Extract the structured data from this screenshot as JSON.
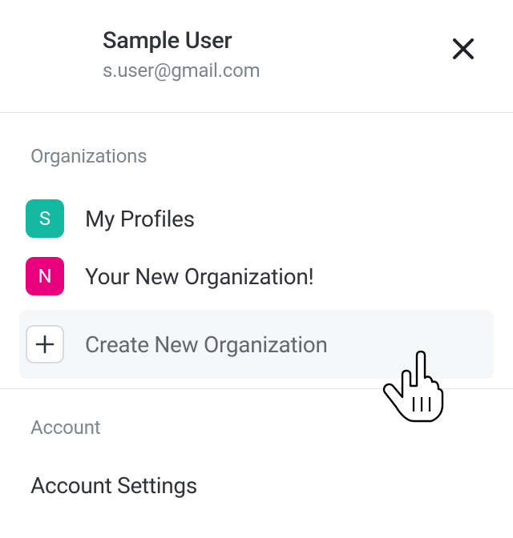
{
  "header": {
    "user_name": "Sample User",
    "user_email": "s.user@gmail.com"
  },
  "organizations": {
    "title": "Organizations",
    "items": [
      {
        "badge": "S",
        "badge_color": "#14b8a0",
        "badge_style": "background:#14b8a0",
        "label": "My Profiles"
      },
      {
        "badge": "N",
        "badge_color": "#e6007e",
        "badge_style": "background:#e6007e",
        "label": "Your New Organization!"
      }
    ],
    "create_label": "Create New Organization"
  },
  "account": {
    "title": "Account",
    "items": [
      {
        "label": "Account Settings"
      }
    ]
  }
}
